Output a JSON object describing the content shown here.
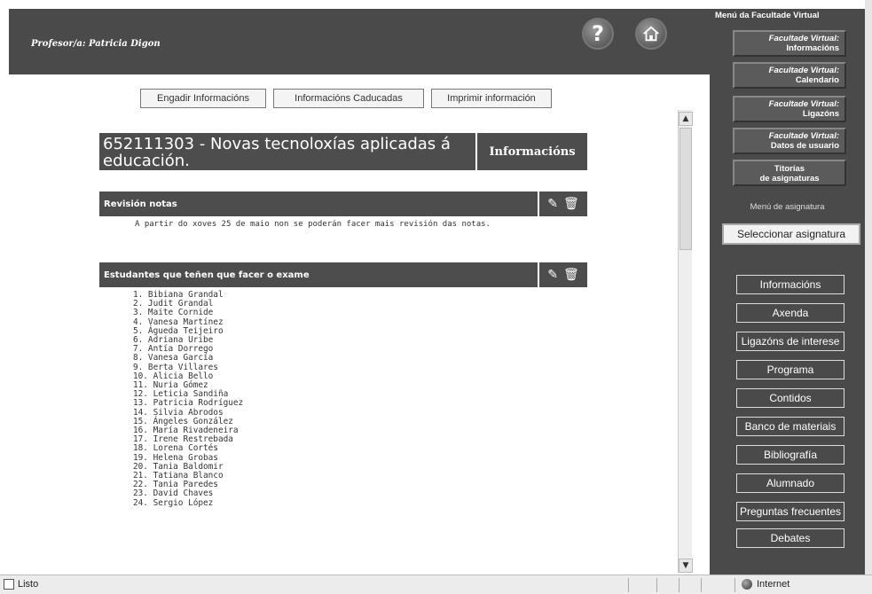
{
  "header": {
    "professor": "Profesor/a: Patricia Digon",
    "help_icon": "question-mark-icon",
    "help_glyph": "?",
    "home_icon": "home-icon"
  },
  "toolbar": {
    "add_label": "Engadir Informacións",
    "expired_label": "Informacións Caducadas",
    "print_label": "Imprimir información"
  },
  "course": {
    "title": "652111303 - Novas tecnoloxías aplicadas á educación.",
    "section": "Informacións"
  },
  "news": [
    {
      "title": "Revisión notas",
      "body": "A partir do xoves 25 de maio non se poderán facer mais revisión das notas."
    },
    {
      "title": "Estudantes que teñen que facer o exame",
      "students": [
        "1. Bibiana Grandal",
        "2. Judit Grandal",
        "3. Maite Cornide",
        "4. Vanesa Martínez",
        "5. Águeda Teijeiro",
        "6. Adriana Uribe",
        "7. Antía Dorrego",
        "8. Vanesa García",
        "9. Berta Villares",
        "10. Alicia Bello",
        "11. Nuria Gómez",
        "12. Leticia Sandiña",
        "13. Patricia Rodríguez",
        "14. Silvia Abrodos",
        "15. Ángeles González",
        "16. María Rivadeneira",
        "17. Irene Restrebada",
        "18. Lorena Cortés",
        "19. Helena Grobas",
        "20. Tania Baldomir",
        "21. Tatiana Blanco",
        "22. Tania Paredes",
        "23. David Chaves",
        "24. Sergio López"
      ]
    }
  ],
  "sidebar": {
    "heading": "Menú da Facultade Virtual",
    "fv_buttons": [
      {
        "line1": "Facultade Virtual:",
        "line2": "Informacións"
      },
      {
        "line1": "Facultade Virtual:",
        "line2": "Calendario"
      },
      {
        "line1": "Facultade Virtual:",
        "line2": "Ligazóns"
      },
      {
        "line1": "Facultade Virtual:",
        "line2": "Datos de usuario"
      }
    ],
    "tutorials": {
      "line1": "Titorías",
      "line2": "de asignaturas"
    },
    "subject_menu_heading": "Menú de asignatura",
    "select_subject": "Seleccionar asignatura",
    "menu": [
      "Informacións",
      "Axenda",
      "Ligazóns de interese",
      "Programa",
      "Contidos",
      "Banco de materiais",
      "Bibliografía",
      "Alumnado",
      "Preguntas frecuentes",
      "Debates"
    ]
  },
  "statusbar": {
    "status": "Listo",
    "zone": "Internet"
  },
  "icons": {
    "edit": "edit-icon",
    "delete": "trash-icon"
  }
}
